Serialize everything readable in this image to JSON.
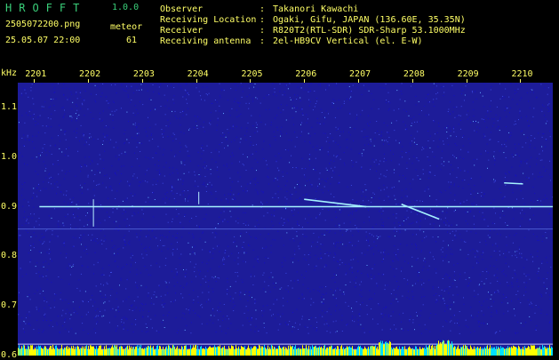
{
  "header": {
    "app_name": "HROFFT",
    "app_version": "1.0.0",
    "filename": "2505072200.png",
    "datetime": "25.05.07 22:00",
    "meteor_label": "meteor",
    "meteor_count": "61",
    "info": [
      {
        "label": "Observer",
        "value": "Takanori Kawachi"
      },
      {
        "label": "Receiving Location",
        "value": "Ogaki, Gifu, JAPAN (136.60E, 35.35N)"
      },
      {
        "label": "Receiver",
        "value": "R820T2(RTL-SDR) SDR-Sharp 53.1000MHz"
      },
      {
        "label": "Receiving antenna",
        "value": "2el-HB9CV Vertical (el. E-W)"
      }
    ],
    "separator": ":"
  },
  "colors": {
    "background": "#000000",
    "plot_bg": "#1d1c99",
    "text": "#ffff66",
    "title": "#3ad07a",
    "signal": "#a6f3ff"
  },
  "chart_data": {
    "type": "heatmap",
    "y_unit": "kHz",
    "x_ticks": [
      "2201",
      "2202",
      "2203",
      "2204",
      "2205",
      "2206",
      "2207",
      "2208",
      "2209",
      "2210"
    ],
    "y_ticks": [
      "1.1",
      "1.0",
      "0.9",
      "0.8",
      "0.7",
      "0.6"
    ],
    "ylim": [
      0.6,
      1.15
    ],
    "carrier_khz": 0.9,
    "meteor_echoes": [
      {
        "t_start": 2206.0,
        "f_start": 0.915,
        "t_end": 2207.15,
        "f_end": 0.9
      },
      {
        "t_start": 2207.8,
        "f_start": 0.905,
        "t_end": 2208.5,
        "f_end": 0.875
      },
      {
        "t_start": 2209.7,
        "f_start": 0.948,
        "t_end": 2210.05,
        "f_end": 0.946
      }
    ]
  }
}
